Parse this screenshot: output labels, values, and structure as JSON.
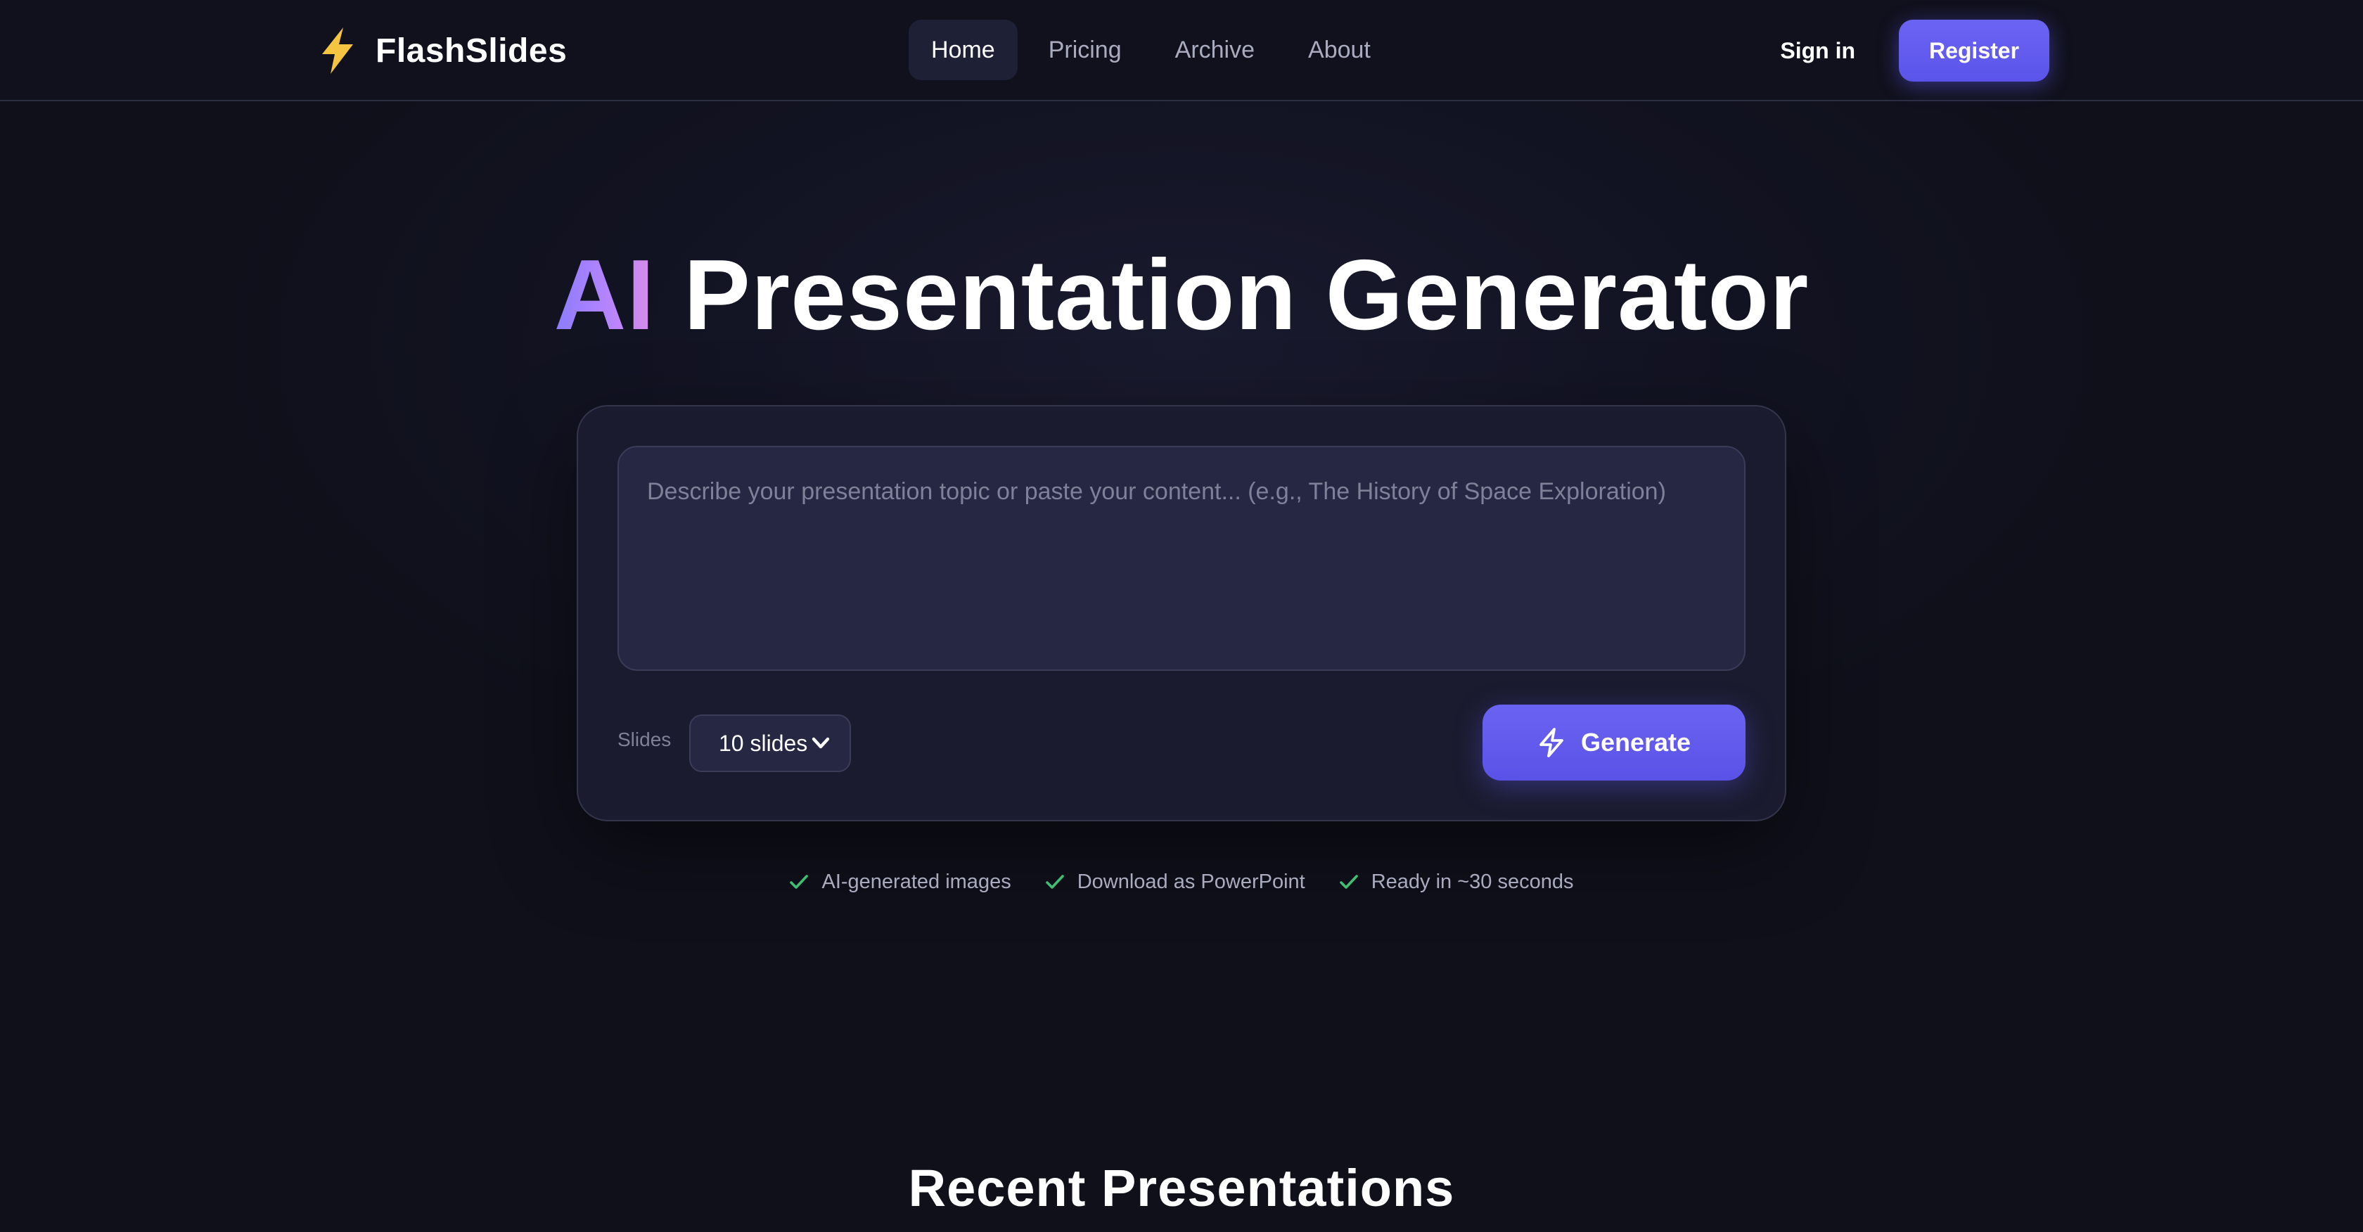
{
  "brand": {
    "name": "FlashSlides",
    "logo_icon": "lightning-bolt-icon",
    "logo_color": "#f5c542"
  },
  "nav": {
    "links": [
      {
        "label": "Home",
        "active": true
      },
      {
        "label": "Pricing",
        "active": false
      },
      {
        "label": "Archive",
        "active": false
      },
      {
        "label": "About",
        "active": false
      }
    ]
  },
  "auth": {
    "signin_label": "Sign in",
    "register_label": "Register"
  },
  "hero": {
    "title_accent": "AI",
    "title_rest": " Presentation Generator"
  },
  "generator": {
    "topic_placeholder": "Describe your presentation topic or paste your content... (e.g., The History of Space Exploration)",
    "topic_value": "",
    "slides_label": "Slides",
    "slides_selected": "10 slides",
    "generate_label": "Generate",
    "generate_icon": "lightning-outline-icon"
  },
  "features": [
    {
      "icon": "check-icon",
      "text": "AI-generated images"
    },
    {
      "icon": "check-icon",
      "text": "Download as PowerPoint"
    },
    {
      "icon": "check-icon",
      "text": "Ready in ~30 seconds"
    }
  ],
  "recent": {
    "title": "Recent Presentations"
  },
  "colors": {
    "accent": "#5f58ee",
    "background": "#10111c",
    "card": "#1a1b2e",
    "check": "#3fbf74"
  }
}
